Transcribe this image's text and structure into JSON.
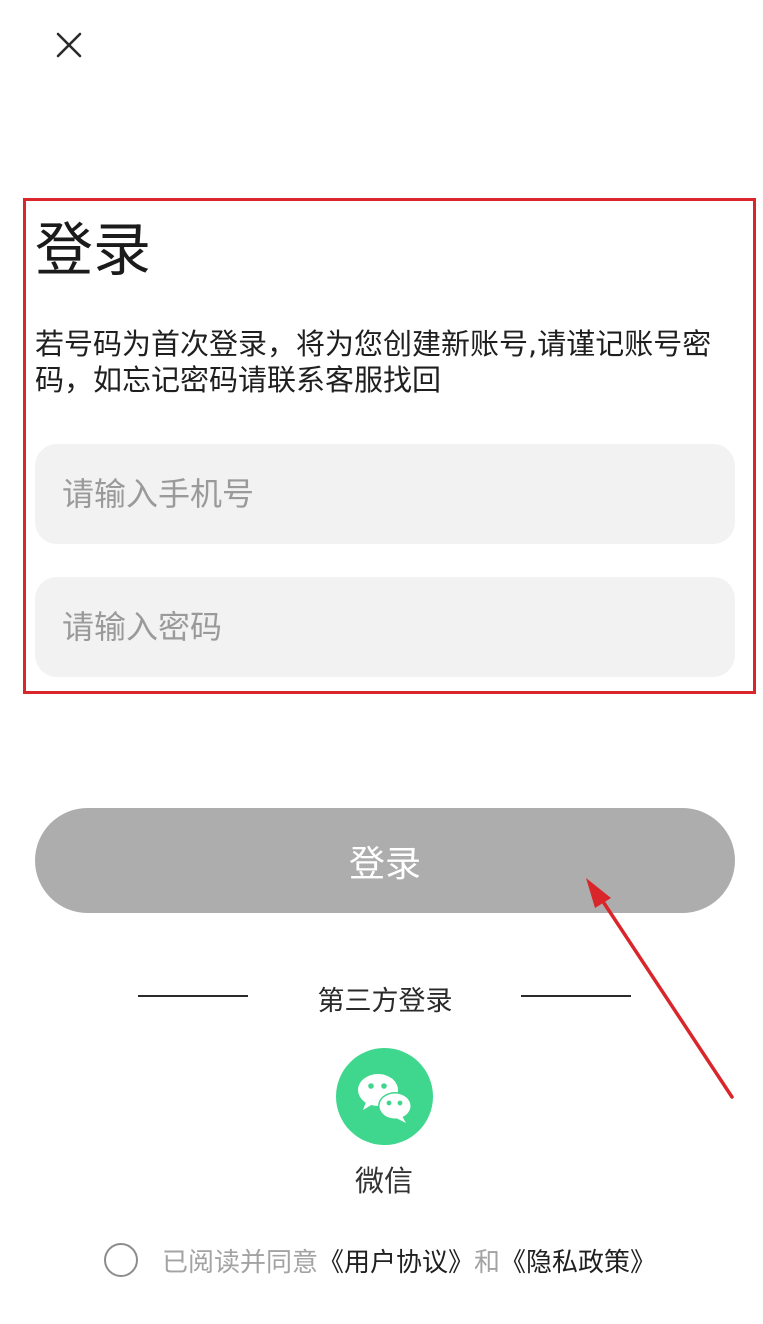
{
  "header": {
    "close_icon": "close-icon"
  },
  "login_form": {
    "title": "登录",
    "notice": "若号码为首次登录，将为您创建新账号,请谨记账号密码，如忘记密码请联系客服找回",
    "phone_placeholder": "请输入手机号",
    "password_placeholder": "请输入密码"
  },
  "actions": {
    "login_label": "登录"
  },
  "third_party": {
    "divider_label": "第三方登录",
    "wechat_icon": "wechat-icon",
    "wechat_label": "微信"
  },
  "agreement": {
    "prefix": "已阅读并同意",
    "user_agreement": "《用户协议》",
    "and_text": "和",
    "privacy_policy": "《隐私政策》"
  },
  "annotations": {
    "highlight_color": "#d8262b"
  },
  "colors": {
    "button_disabled": "#adadad",
    "input_background": "#f2f2f2",
    "wechat_green": "#3fd68e"
  }
}
